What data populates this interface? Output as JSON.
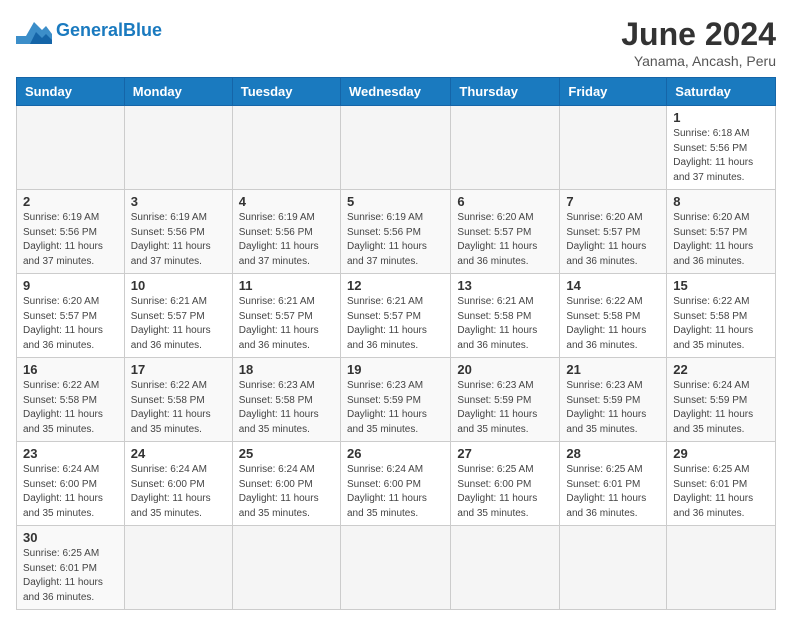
{
  "header": {
    "logo_general": "General",
    "logo_blue": "Blue",
    "title": "June 2024",
    "location": "Yanama, Ancash, Peru"
  },
  "weekdays": [
    "Sunday",
    "Monday",
    "Tuesday",
    "Wednesday",
    "Thursday",
    "Friday",
    "Saturday"
  ],
  "weeks": [
    [
      {
        "day": "",
        "info": ""
      },
      {
        "day": "",
        "info": ""
      },
      {
        "day": "",
        "info": ""
      },
      {
        "day": "",
        "info": ""
      },
      {
        "day": "",
        "info": ""
      },
      {
        "day": "",
        "info": ""
      },
      {
        "day": "1",
        "info": "Sunrise: 6:18 AM\nSunset: 5:56 PM\nDaylight: 11 hours and 37 minutes."
      }
    ],
    [
      {
        "day": "2",
        "info": "Sunrise: 6:19 AM\nSunset: 5:56 PM\nDaylight: 11 hours and 37 minutes."
      },
      {
        "day": "3",
        "info": "Sunrise: 6:19 AM\nSunset: 5:56 PM\nDaylight: 11 hours and 37 minutes."
      },
      {
        "day": "4",
        "info": "Sunrise: 6:19 AM\nSunset: 5:56 PM\nDaylight: 11 hours and 37 minutes."
      },
      {
        "day": "5",
        "info": "Sunrise: 6:19 AM\nSunset: 5:56 PM\nDaylight: 11 hours and 37 minutes."
      },
      {
        "day": "6",
        "info": "Sunrise: 6:20 AM\nSunset: 5:57 PM\nDaylight: 11 hours and 36 minutes."
      },
      {
        "day": "7",
        "info": "Sunrise: 6:20 AM\nSunset: 5:57 PM\nDaylight: 11 hours and 36 minutes."
      },
      {
        "day": "8",
        "info": "Sunrise: 6:20 AM\nSunset: 5:57 PM\nDaylight: 11 hours and 36 minutes."
      }
    ],
    [
      {
        "day": "9",
        "info": "Sunrise: 6:20 AM\nSunset: 5:57 PM\nDaylight: 11 hours and 36 minutes."
      },
      {
        "day": "10",
        "info": "Sunrise: 6:21 AM\nSunset: 5:57 PM\nDaylight: 11 hours and 36 minutes."
      },
      {
        "day": "11",
        "info": "Sunrise: 6:21 AM\nSunset: 5:57 PM\nDaylight: 11 hours and 36 minutes."
      },
      {
        "day": "12",
        "info": "Sunrise: 6:21 AM\nSunset: 5:57 PM\nDaylight: 11 hours and 36 minutes."
      },
      {
        "day": "13",
        "info": "Sunrise: 6:21 AM\nSunset: 5:58 PM\nDaylight: 11 hours and 36 minutes."
      },
      {
        "day": "14",
        "info": "Sunrise: 6:22 AM\nSunset: 5:58 PM\nDaylight: 11 hours and 36 minutes."
      },
      {
        "day": "15",
        "info": "Sunrise: 6:22 AM\nSunset: 5:58 PM\nDaylight: 11 hours and 35 minutes."
      }
    ],
    [
      {
        "day": "16",
        "info": "Sunrise: 6:22 AM\nSunset: 5:58 PM\nDaylight: 11 hours and 35 minutes."
      },
      {
        "day": "17",
        "info": "Sunrise: 6:22 AM\nSunset: 5:58 PM\nDaylight: 11 hours and 35 minutes."
      },
      {
        "day": "18",
        "info": "Sunrise: 6:23 AM\nSunset: 5:58 PM\nDaylight: 11 hours and 35 minutes."
      },
      {
        "day": "19",
        "info": "Sunrise: 6:23 AM\nSunset: 5:59 PM\nDaylight: 11 hours and 35 minutes."
      },
      {
        "day": "20",
        "info": "Sunrise: 6:23 AM\nSunset: 5:59 PM\nDaylight: 11 hours and 35 minutes."
      },
      {
        "day": "21",
        "info": "Sunrise: 6:23 AM\nSunset: 5:59 PM\nDaylight: 11 hours and 35 minutes."
      },
      {
        "day": "22",
        "info": "Sunrise: 6:24 AM\nSunset: 5:59 PM\nDaylight: 11 hours and 35 minutes."
      }
    ],
    [
      {
        "day": "23",
        "info": "Sunrise: 6:24 AM\nSunset: 6:00 PM\nDaylight: 11 hours and 35 minutes."
      },
      {
        "day": "24",
        "info": "Sunrise: 6:24 AM\nSunset: 6:00 PM\nDaylight: 11 hours and 35 minutes."
      },
      {
        "day": "25",
        "info": "Sunrise: 6:24 AM\nSunset: 6:00 PM\nDaylight: 11 hours and 35 minutes."
      },
      {
        "day": "26",
        "info": "Sunrise: 6:24 AM\nSunset: 6:00 PM\nDaylight: 11 hours and 35 minutes."
      },
      {
        "day": "27",
        "info": "Sunrise: 6:25 AM\nSunset: 6:00 PM\nDaylight: 11 hours and 35 minutes."
      },
      {
        "day": "28",
        "info": "Sunrise: 6:25 AM\nSunset: 6:01 PM\nDaylight: 11 hours and 36 minutes."
      },
      {
        "day": "29",
        "info": "Sunrise: 6:25 AM\nSunset: 6:01 PM\nDaylight: 11 hours and 36 minutes."
      }
    ],
    [
      {
        "day": "30",
        "info": "Sunrise: 6:25 AM\nSunset: 6:01 PM\nDaylight: 11 hours and 36 minutes."
      },
      {
        "day": "",
        "info": ""
      },
      {
        "day": "",
        "info": ""
      },
      {
        "day": "",
        "info": ""
      },
      {
        "day": "",
        "info": ""
      },
      {
        "day": "",
        "info": ""
      },
      {
        "day": "",
        "info": ""
      }
    ]
  ]
}
